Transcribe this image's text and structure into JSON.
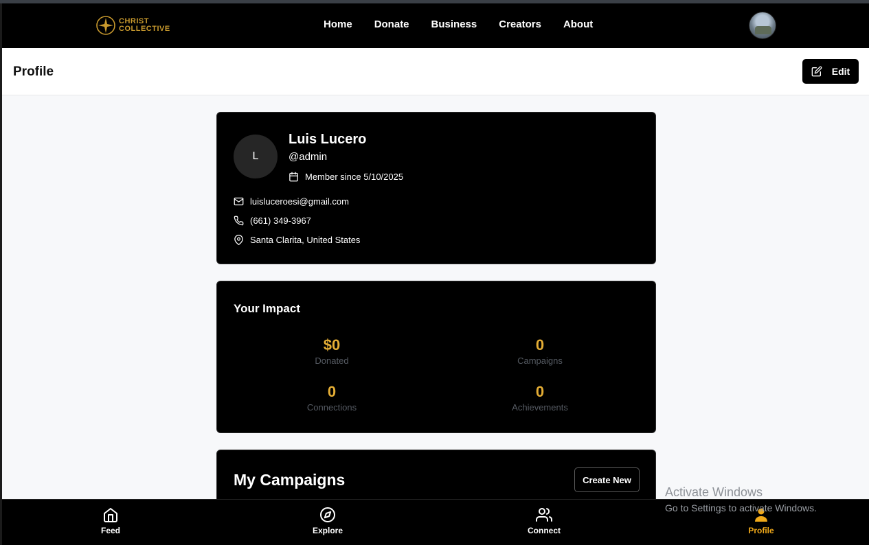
{
  "header": {
    "logo_line1": "CHRIST",
    "logo_line2": "COLLECTIVE",
    "nav": [
      "Home",
      "Donate",
      "Business",
      "Creators",
      "About"
    ]
  },
  "page": {
    "title": "Profile",
    "edit_label": "Edit"
  },
  "profile": {
    "initial": "L",
    "name": "Luis Lucero",
    "handle": "@admin",
    "member_since": "Member since 5/10/2025",
    "email": "luisluceroesi@gmail.com",
    "phone": "(661) 349-3967",
    "location": "Santa Clarita, United States"
  },
  "impact": {
    "title": "Your Impact",
    "stats": [
      {
        "value": "$0",
        "label": "Donated"
      },
      {
        "value": "0",
        "label": "Campaigns"
      },
      {
        "value": "0",
        "label": "Connections"
      },
      {
        "value": "0",
        "label": "Achievements"
      }
    ]
  },
  "campaigns": {
    "title": "My Campaigns",
    "create_label": "Create New"
  },
  "bottom_nav": [
    {
      "label": "Feed"
    },
    {
      "label": "Explore"
    },
    {
      "label": "Connect"
    },
    {
      "label": "Profile"
    }
  ],
  "watermark": {
    "line1": "Activate Windows",
    "line2": "Go to Settings to activate Windows."
  },
  "colors": {
    "accent": "#e4ad35",
    "active_nav": "#f0a91a",
    "brand_gold": "#c99a2e"
  }
}
